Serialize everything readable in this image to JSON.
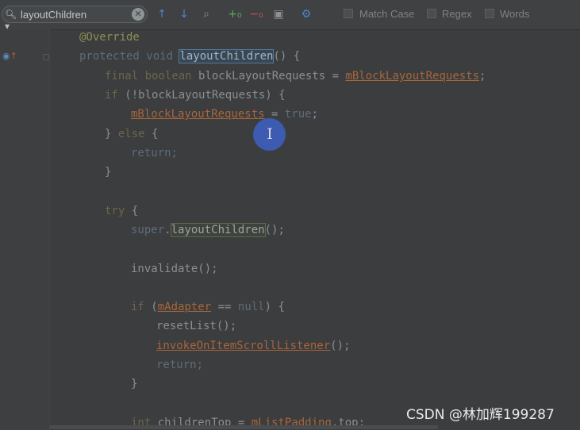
{
  "find_bar": {
    "search_value": "layoutChildren",
    "search_icon": "search-dropdown-icon",
    "clear_icon": "clear-icon",
    "icons": [
      "arrow-up-icon",
      "arrow-down-icon",
      "find-in-files-icon",
      "add-occurrence-icon",
      "remove-occurrence-icon",
      "select-all-occurrences-icon",
      "gear-icon"
    ],
    "options": [
      {
        "label": "Match Case",
        "checked": false
      },
      {
        "label": "Regex",
        "checked": false
      },
      {
        "label": "Words",
        "checked": false
      }
    ]
  },
  "code": {
    "lines": [
      "@Override",
      "protected void layoutChildren() {",
      "final boolean blockLayoutRequests = mBlockLayoutRequests;",
      "if (!blockLayoutRequests) {",
      "mBlockLayoutRequests = true;",
      "} else {",
      "return;",
      "}",
      "try {",
      "super.layoutChildren();",
      "invalidate();",
      "if (mAdapter == null) {",
      "resetList();",
      "invokeOnItemScrollListener();",
      "return;",
      "}",
      "int childrenTop = mListPadding.top;"
    ]
  },
  "colors": {
    "background": "#3b3d3e",
    "keyword": "#6f6549",
    "field": "#a9653c",
    "annotation": "#8d8f55",
    "search_highlight": "#5477a0",
    "cursor_halo": "#3c64d2"
  },
  "watermark": "CSDN @林加辉199287"
}
